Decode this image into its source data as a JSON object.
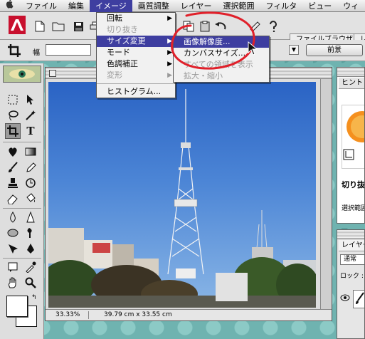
{
  "menubar": {
    "apple": "",
    "items": [
      "ファイル",
      "編集",
      "イメージ",
      "画質調整",
      "レイヤー",
      "選択範囲",
      "フィルタ",
      "ビュー",
      "ウィ"
    ]
  },
  "image_menu": {
    "items": [
      {
        "label": "回転",
        "submenu": true,
        "disabled": false
      },
      {
        "label": "切り抜き",
        "submenu": false,
        "disabled": true
      },
      {
        "label": "サイズ変更",
        "submenu": true,
        "disabled": false
      },
      {
        "label": "モード",
        "submenu": true,
        "disabled": false
      },
      {
        "label": "色調補正",
        "submenu": true,
        "disabled": false
      },
      {
        "label": "変形",
        "submenu": true,
        "disabled": true
      },
      {
        "label": "ヒストグラム...",
        "submenu": false,
        "disabled": false
      }
    ]
  },
  "resize_submenu": {
    "items": [
      {
        "label": "画像解像度...",
        "disabled": false
      },
      {
        "label": "カンバスサイズ...",
        "disabled": false
      },
      {
        "label": "すべての領域を表示",
        "disabled": true
      },
      {
        "label": "拡大・縮小",
        "disabled": true
      }
    ]
  },
  "options_bar": {
    "width_label": "幅",
    "front_image_button": "前景",
    "palette_tab": "ファイルブラウザ",
    "palette_tab2": "レ"
  },
  "document": {
    "zoom": "33.33%",
    "doc_size": "39.79 cm x 33.55 cm"
  },
  "hint_panel": {
    "title": "ヒント",
    "heading": "切り抜",
    "text": "選択範囲"
  },
  "layers_panel": {
    "title": "レイヤー",
    "blend_mode": "通常",
    "lock_label": "ロック :"
  },
  "colors": {
    "menu_highlight": "#3e3ea0",
    "annotation_red": "#e0202a"
  }
}
